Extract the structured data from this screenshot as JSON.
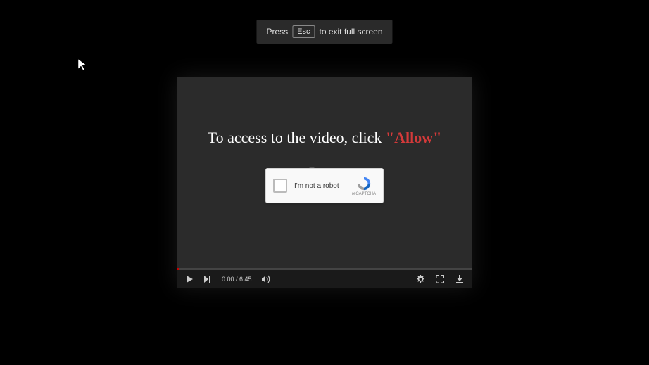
{
  "esc_notice": {
    "prefix": "Press",
    "key": "Esc",
    "suffix": "to exit full screen"
  },
  "video": {
    "access_prefix": "To access to the video, click ",
    "access_highlight": "\"Allow\"",
    "current_time": "0:00",
    "duration": "6:45",
    "time_separator": " / "
  },
  "recaptcha": {
    "label": "I'm not a robot",
    "brand": "reCAPTCHA"
  }
}
